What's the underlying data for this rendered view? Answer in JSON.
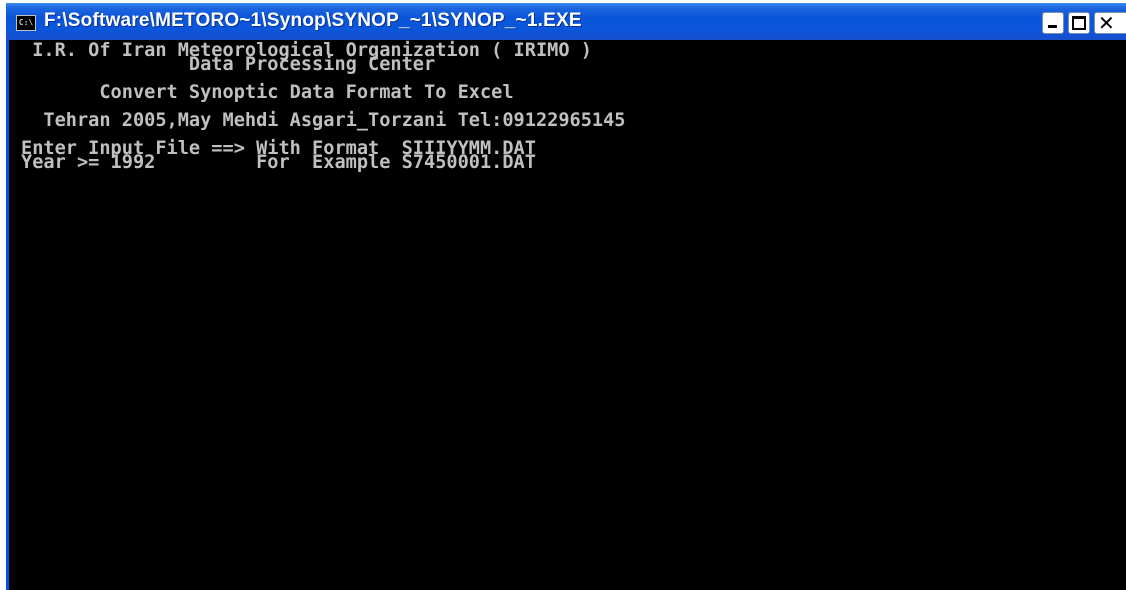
{
  "window": {
    "title": "F:\\Software\\METORO~1\\Synop\\SYNOP_~1\\SYNOP_~1.EXE",
    "icon_label": "C:\\",
    "icon": "console-icon",
    "controls": {
      "minimize": "minimize-icon",
      "maximize": "maximize-icon",
      "close": "close-icon"
    },
    "colors": {
      "titlebar": "#0a55d8",
      "console_bg": "#000000",
      "console_text": "#c0c0c0"
    }
  },
  "console": {
    "lines": [
      " I.R. Of Iran Meteorological Organization ( IRIMO )",
      "               Data Processing Center",
      "",
      "       Convert Synoptic Data Format To Excel",
      "",
      "  Tehran 2005,May Mehdi Asgari_Torzani Tel:09122965145",
      "",
      "Enter Input File ==> With Format  SIIIYYMM.DAT",
      "Year >= 1992         For  Example S7450001.DAT"
    ]
  }
}
